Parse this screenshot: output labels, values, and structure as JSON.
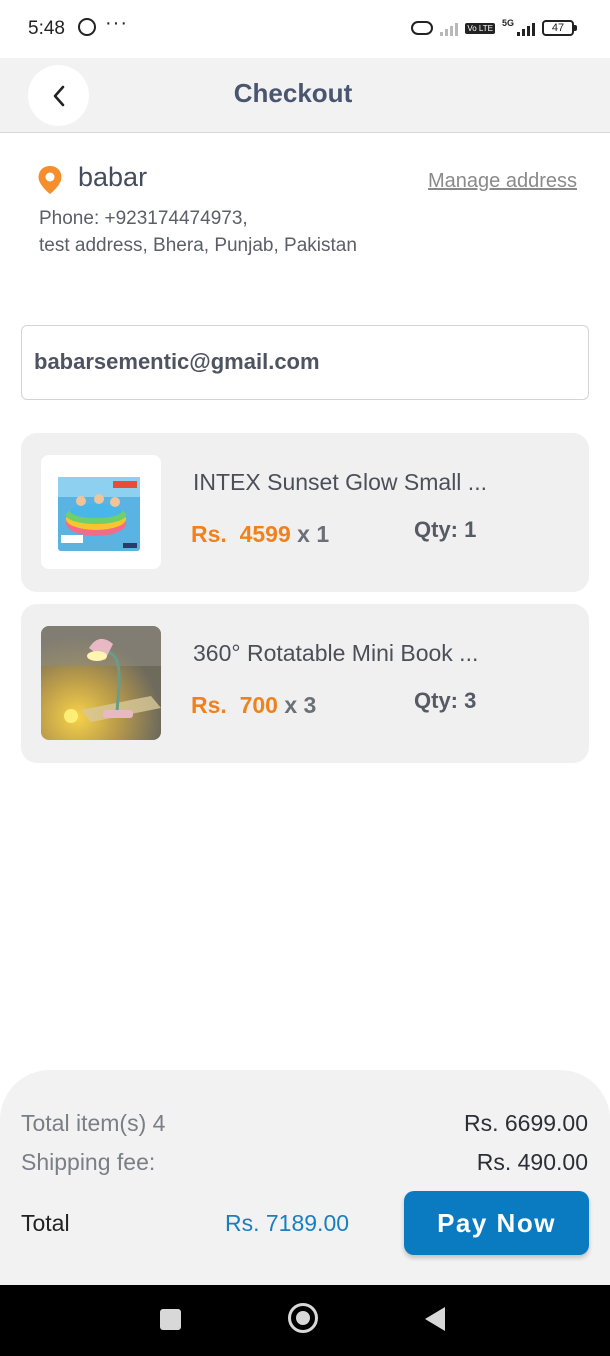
{
  "status_bar": {
    "time": "5:48",
    "network_5g": "5G",
    "volte": "Vo LTE",
    "battery": "47"
  },
  "header": {
    "title": "Checkout",
    "back_icon": "chevron-left-icon"
  },
  "address": {
    "icon": "location-pin-icon",
    "name": "babar",
    "manage_label": "Manage address",
    "phone": "Phone: +923174474973,",
    "line": "test address, Bhera, Punjab, Pakistan"
  },
  "email": "babarsementic@gmail.com",
  "items": [
    {
      "name": "INTEX Sunset Glow Small ...",
      "currency": "Rs.",
      "price": "4599",
      "multiplier": "x 1",
      "qty": "Qty: 1"
    },
    {
      "name": "360° Rotatable Mini Book ...",
      "currency": "Rs.",
      "price": "700",
      "multiplier": "x 3",
      "qty": "Qty: 3"
    }
  ],
  "summary": {
    "items_label": "Total item(s) 4",
    "items_value": "Rs.  6699.00",
    "shipping_label": "Shipping fee:",
    "shipping_value": "Rs.  490.00",
    "total_label": "Total",
    "total_value": "Rs.  7189.00",
    "pay_label": "Pay Now"
  },
  "colors": {
    "accent_orange": "#f0821e",
    "accent_blue": "#0a7bc0",
    "total_blue": "#1a7fc1"
  }
}
